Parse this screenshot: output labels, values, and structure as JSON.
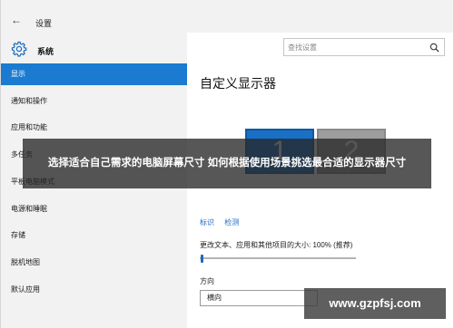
{
  "titlebar": {
    "back_arrow": "←",
    "title": "设置"
  },
  "sidebar": {
    "header": "系统",
    "items": [
      {
        "label": "显示",
        "selected": true
      },
      {
        "label": "通知和操作"
      },
      {
        "label": "应用和功能"
      },
      {
        "label": "多任务"
      },
      {
        "label": "平板电脑模式"
      },
      {
        "label": "电源和睡眠"
      },
      {
        "label": "存储"
      },
      {
        "label": "脱机地图"
      },
      {
        "label": "默认应用"
      }
    ]
  },
  "search": {
    "placeholder": "查找设置"
  },
  "main": {
    "title": "自定义显示器",
    "monitors": [
      {
        "number": "1"
      },
      {
        "number": "2"
      }
    ],
    "links": {
      "identify": "标识",
      "detect": "检测"
    },
    "scale_label": "更改文本、应用和其他项目的大小: 100% (推荐)",
    "scale_value_percent": 0,
    "orientation_label": "方向",
    "orientation_value": "横向"
  },
  "banner": {
    "text": "选择适合自己需求的电脑屏幕尺寸 如何根据使用场景挑选最合适的显示器尺寸"
  },
  "watermark": {
    "text": "www.gzpfsj.com"
  },
  "colors": {
    "accent": "#1a7bd1",
    "monitor1": "#1a70c4",
    "monitor2": "#9d9d9d"
  },
  "icons": {
    "settings": "gear-icon",
    "search": "search-icon",
    "back": "back-arrow-icon"
  }
}
